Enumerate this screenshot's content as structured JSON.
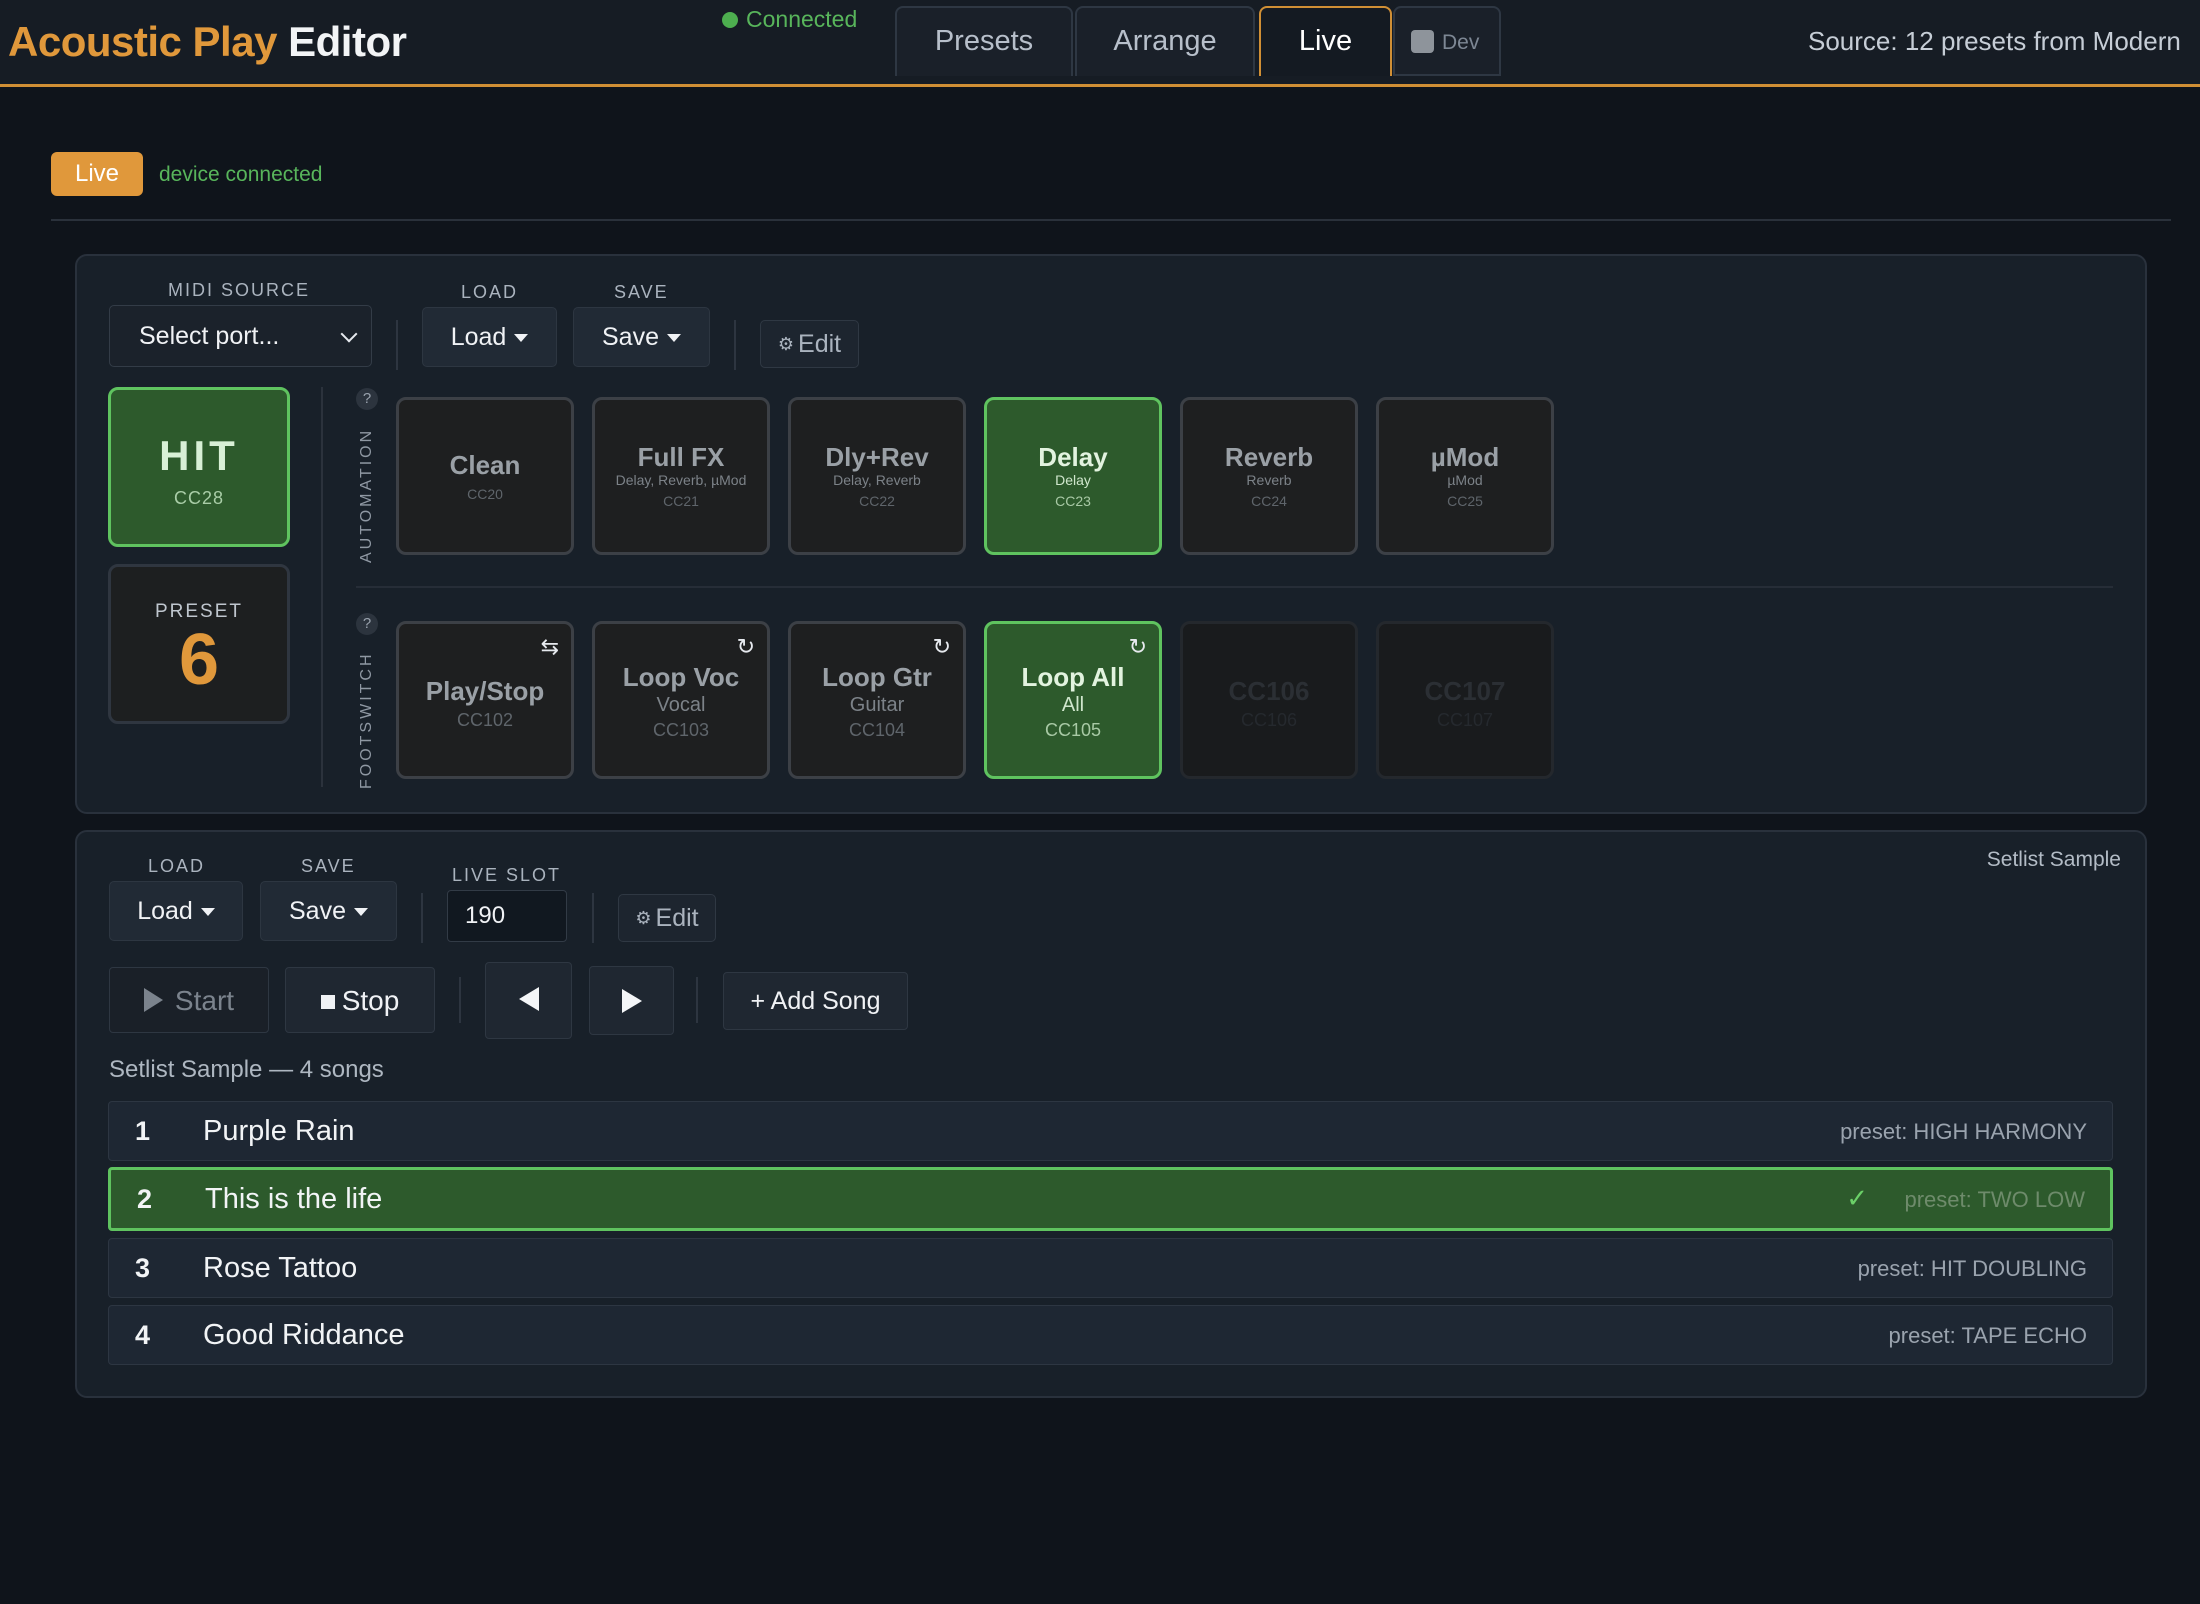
{
  "header": {
    "brand_part1": "Acoustic Play",
    "brand_part2": "Editor",
    "connection_status": "Connected",
    "tabs": [
      {
        "label": "Presets",
        "active": false
      },
      {
        "label": "Arrange",
        "active": false
      },
      {
        "label": "Live",
        "active": true
      }
    ],
    "dev_label": "Dev",
    "dev_checked": false,
    "source_text": "Source: 12 presets from Modern"
  },
  "status": {
    "mode_badge": "Live",
    "device_status": "device connected"
  },
  "controller": {
    "midi_source_label": "MIDI SOURCE",
    "midi_source_value": "Select port...",
    "load_label": "LOAD",
    "load_button": "Load",
    "save_label": "SAVE",
    "save_button": "Save",
    "edit_button": "Edit",
    "hit": {
      "title": "HIT",
      "cc": "CC28"
    },
    "preset": {
      "label": "PRESET",
      "number": "6"
    },
    "automation_label": "AUTOMATION",
    "footswitch_label": "FOOTSWITCH",
    "help_glyph": "?",
    "automation_pads": [
      {
        "name": "Clean",
        "sub": "",
        "cc": "CC20",
        "active": false
      },
      {
        "name": "Full FX",
        "sub": "Delay, Reverb, µMod",
        "cc": "CC21",
        "active": false
      },
      {
        "name": "Dly+Rev",
        "sub": "Delay, Reverb",
        "cc": "CC22",
        "active": false
      },
      {
        "name": "Delay",
        "sub": "Delay",
        "cc": "CC23",
        "active": true
      },
      {
        "name": "Reverb",
        "sub": "Reverb",
        "cc": "CC24",
        "active": false
      },
      {
        "name": "µMod",
        "sub": "µMod",
        "cc": "CC25",
        "active": false
      }
    ],
    "footswitch_pads": [
      {
        "name": "Play/Stop",
        "sub": "",
        "cc": "CC102",
        "icon": "swap-icon",
        "active": false
      },
      {
        "name": "Loop Voc",
        "sub": "Vocal",
        "cc": "CC103",
        "icon": "loop-icon",
        "active": false
      },
      {
        "name": "Loop Gtr",
        "sub": "Guitar",
        "cc": "CC104",
        "icon": "loop-icon",
        "active": false
      },
      {
        "name": "Loop All",
        "sub": "All",
        "cc": "CC105",
        "icon": "loop-icon",
        "active": true
      },
      {
        "name": "CC106",
        "sub": "",
        "cc": "CC106",
        "icon": "",
        "active": false,
        "disabled": true
      },
      {
        "name": "CC107",
        "sub": "",
        "cc": "CC107",
        "icon": "",
        "active": false,
        "disabled": true
      }
    ]
  },
  "setlist": {
    "name": "Setlist Sample",
    "load_label": "LOAD",
    "load_button": "Load",
    "save_label": "SAVE",
    "save_button": "Save",
    "live_slot_label": "LIVE SLOT",
    "live_slot_value": "190",
    "edit_button": "Edit",
    "start_button": "Start",
    "stop_button": "Stop",
    "add_song_button": "+ Add Song",
    "summary": "Setlist Sample — 4 songs",
    "songs": [
      {
        "number": "1",
        "title": "Purple Rain",
        "preset": "preset: HIGH HARMONY",
        "current": false
      },
      {
        "number": "2",
        "title": "This is the life",
        "preset": "preset: TWO LOW",
        "current": true
      },
      {
        "number": "3",
        "title": "Rose Tattoo",
        "preset": "preset: HIT DOUBLING",
        "current": false
      },
      {
        "number": "4",
        "title": "Good Riddance",
        "preset": "preset: TAPE ECHO",
        "current": false
      }
    ]
  },
  "colors": {
    "accent": "#e0983b",
    "active_green": "#5fc35f",
    "active_fill": "#2d5a2c",
    "background": "#0f141b"
  }
}
